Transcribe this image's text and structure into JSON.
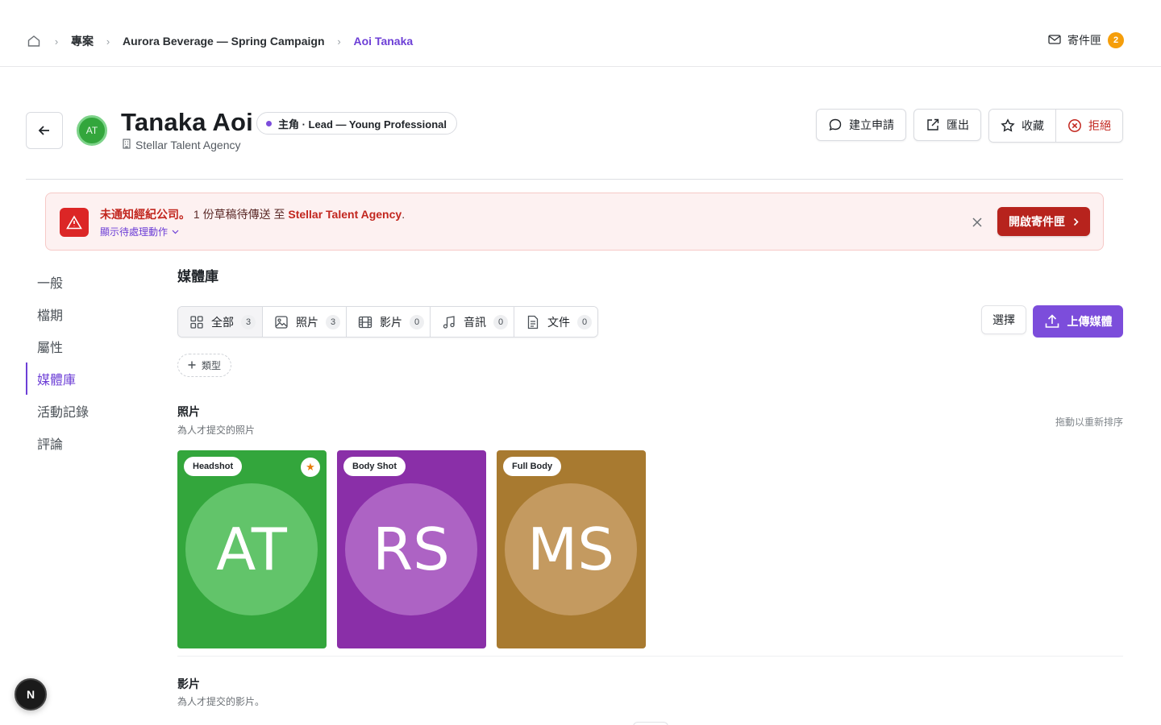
{
  "breadcrumb": {
    "items": [
      "專案",
      "Aurora Beverage — Spring Campaign",
      "Aoi Tanaka"
    ]
  },
  "inbox": {
    "label": "寄件匣",
    "count": "2"
  },
  "header": {
    "avatar_initials": "AT",
    "name": "Tanaka Aoi",
    "role": "主角 · Lead — Young Professional",
    "agency": "Stellar Talent Agency",
    "actions": {
      "request": "建立申請",
      "export": "匯出",
      "favorite": "收藏",
      "reject": "拒絕"
    }
  },
  "alert": {
    "title": "未通知經紀公司。",
    "message_prefix": "1 份草稿待傳送 至",
    "agency": "Stellar Talent Agency",
    "message_suffix": ".",
    "toggle": "顯示待處理動作",
    "cta": "開啟寄件匣"
  },
  "sidebar": {
    "items": [
      {
        "label": "一般"
      },
      {
        "label": "檔期"
      },
      {
        "label": "屬性"
      },
      {
        "label": "媒體庫"
      },
      {
        "label": "活動記錄"
      },
      {
        "label": "評論"
      }
    ],
    "active_index": 3
  },
  "media": {
    "title": "媒體庫",
    "filters": [
      {
        "label": "全部",
        "count": "3",
        "icon": "grid-icon"
      },
      {
        "label": "照片",
        "count": "3",
        "icon": "image-icon"
      },
      {
        "label": "影片",
        "count": "0",
        "icon": "film-icon"
      },
      {
        "label": "音訊",
        "count": "0",
        "icon": "music-icon"
      },
      {
        "label": "文件",
        "count": "0",
        "icon": "document-icon"
      }
    ],
    "select_label": "選擇",
    "upload_label": "上傳媒體",
    "type_chip": "類型",
    "photos": {
      "title": "照片",
      "subtitle": "為人才提交的照片",
      "hint": "拖動以重新排序",
      "cards": [
        {
          "tag": "Headshot",
          "initials": "AT",
          "bg": "#33a63c",
          "circle": "#62c46a",
          "starred": true
        },
        {
          "tag": "Body Shot",
          "initials": "RS",
          "bg": "#8a2fa8",
          "circle": "#ad63c4",
          "starred": false
        },
        {
          "tag": "Full Body",
          "initials": "MS",
          "bg": "#a87a30",
          "circle": "#c49a60",
          "starred": false
        }
      ]
    },
    "videos": {
      "title": "影片",
      "subtitle": "為人才提交的影片。"
    }
  },
  "fab": {
    "label": "N"
  },
  "colors": {
    "accent": "#7c4ddb",
    "danger": "#b7231d",
    "badge": "#f59e0b"
  }
}
